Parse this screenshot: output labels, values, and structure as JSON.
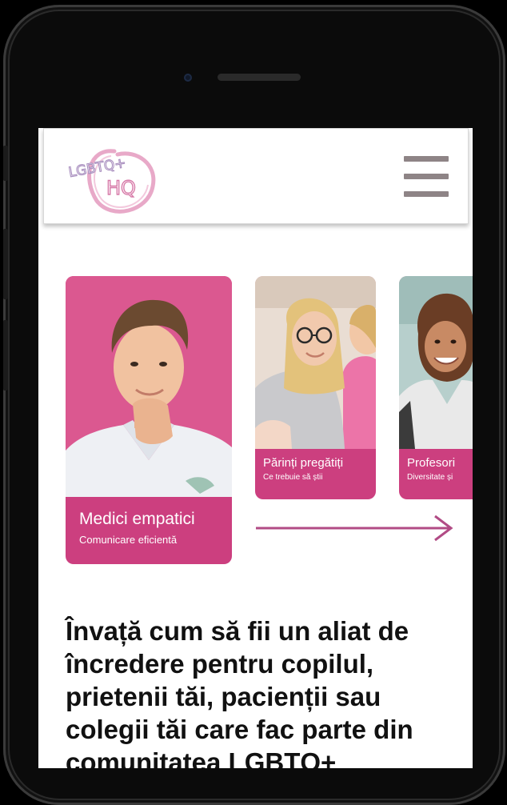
{
  "logo": {
    "line1": "LGBTQ+",
    "line2": "HQ"
  },
  "colors": {
    "accent": "#cc3f7f",
    "menu": "#8e8486",
    "arrow": "#b14b85"
  },
  "icons": {
    "menu": "hamburger-menu-icon",
    "next": "arrow-right-icon"
  },
  "cards": [
    {
      "title": "Medici empatici",
      "subtitle": "Comunicare eficientă"
    },
    {
      "title": "Părinți pregătiți",
      "subtitle": "Ce trebuie să știi"
    },
    {
      "title": "Profesori",
      "subtitle": "Diversitate și"
    }
  ],
  "main": {
    "headline": "Învață cum să fii un aliat de încredere pentru copilul, prietenii tăi, pacienții sau colegii tăi care fac parte din comunitatea LGBTQ+"
  }
}
